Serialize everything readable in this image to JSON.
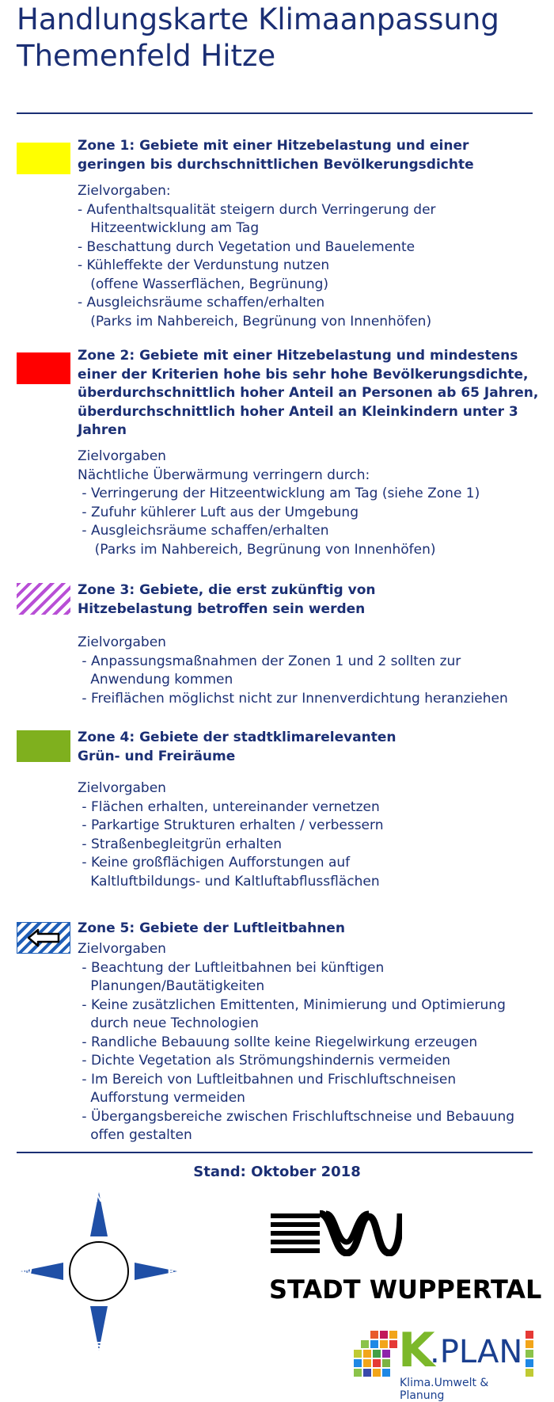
{
  "title_lines": [
    "Handlungskarte Klimaanpassung",
    "Themenfeld Hitze"
  ],
  "colors": {
    "text": "#1b2f74",
    "zone1": "#ffff00",
    "zone2": "#ff0000",
    "zone3": "#b84fd6",
    "zone4": "#7fb01e",
    "zone5": "#1f5fb8"
  },
  "zones": [
    {
      "heading_lines": [
        "Zone 1: Gebiete mit einer Hitzebelastung und einer",
        "geringen bis durchschnittlichen Bevölkerungsdichte"
      ],
      "body_lines": [
        "Zielvorgaben:",
        "- Aufenthaltsqualität steigern durch Verringerung der",
        "   Hitzeentwicklung am Tag",
        "- Beschattung durch Vegetation und Bauelemente",
        "- Kühleffekte der Verdunstung nutzen",
        "   (offene Wasserflächen, Begrünung)",
        "- Ausgleichsräume schaffen/erhalten",
        "   (Parks im Nahbereich, Begrünung von Innenhöfen)"
      ]
    },
    {
      "heading_lines": [
        "Zone 2: Gebiete mit einer Hitzebelastung und mindestens",
        "einer der Kriterien hohe bis sehr hohe Bevölkerungsdichte,",
        "überdurchschnittlich hoher Anteil an Personen ab 65 Jahren,",
        "überdurchschnittlich hoher Anteil an Kleinkindern unter 3",
        "Jahren"
      ],
      "body_lines": [
        "Zielvorgaben",
        "Nächtliche Überwärmung verringern durch:",
        " - Verringerung der Hitzeentwicklung am Tag (siehe Zone 1)",
        " - Zufuhr kühlerer Luft aus der Umgebung",
        " - Ausgleichsräume schaffen/erhalten",
        "    (Parks im Nahbereich, Begrünung von Innenhöfen)"
      ]
    },
    {
      "heading_lines": [
        "Zone 3: Gebiete, die erst zukünftig von",
        "Hitzebelastung betroffen sein werden"
      ],
      "body_lines": [
        "Zielvorgaben",
        " - Anpassungsmaßnahmen der Zonen 1 und 2 sollten zur",
        "   Anwendung kommen",
        " - Freiflächen möglichst nicht zur Innenverdichtung heranziehen"
      ]
    },
    {
      "heading_lines": [
        "Zone 4: Gebiete der stadtklimarelevanten",
        "Grün- und Freiräume"
      ],
      "body_lines": [
        "Zielvorgaben",
        " - Flächen erhalten, untereinander vernetzen",
        " - Parkartige Strukturen erhalten / verbessern",
        " - Straßenbegleitgrün erhalten",
        " - Keine großflächigen Aufforstungen auf",
        "   Kaltluftbildungs- und Kaltluftabflussflächen"
      ]
    },
    {
      "heading_lines": [
        "Zone 5: Gebiete der Luftleitbahnen"
      ],
      "body_lines": [
        "Zielvorgaben",
        " - Beachtung der Luftleitbahnen bei künftigen",
        "   Planungen/Bautätigkeiten",
        " - Keine zusätzlichen Emittenten, Minimierung und Optimierung",
        "   durch neue Technologien",
        " - Randliche Bebauung sollte keine Riegelwirkung erzeugen",
        " - Dichte Vegetation als Strömungshindernis vermeiden",
        " - Im Bereich von Luftleitbahnen und Frischluftschneisen",
        "   Aufforstung vermeiden",
        " - Übergangsbereiche zwischen Frischluftschneise und Bebauung",
        "   offen gestalten"
      ]
    }
  ],
  "stand": "Stand: Oktober 2018",
  "compass": {
    "n": "N",
    "w": "W",
    "s": "S",
    "e": "E"
  },
  "logos": {
    "wuppertal": "STADT WUPPERTAL",
    "kplan_k": "K",
    "kplan_plan": ".PLAN",
    "kplan_tagline": "Klima.Umwelt & Planung"
  }
}
